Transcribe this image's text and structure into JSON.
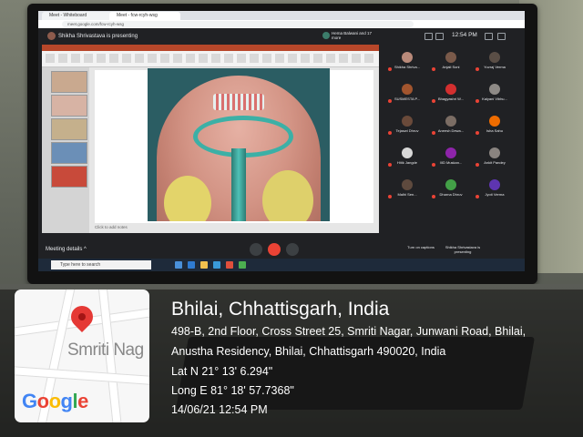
{
  "browser": {
    "tab1": "Meet - Whiteboard",
    "tab2": "Meet - fcw-rcyh-wsg",
    "url": "meet.google.com/fcw-rcyh-wsg"
  },
  "meet": {
    "presenting_text": "Shikha Shrivastava is presenting",
    "joined_text": "Hema Balwani and 17 more",
    "clock": "12:54 PM",
    "meeting_details": "Meeting details",
    "add_notes": "Click to add notes",
    "captions_label": "Turn on captions",
    "presenting_label": "Shikha Shrivastava is presenting",
    "participants": [
      {
        "name": "Shikha Shriva...",
        "color": "#b98a7a"
      },
      {
        "name": "Anjali Soni",
        "color": "#7a5a4a"
      },
      {
        "name": "Yuvraj Verma",
        "color": "#5a4e46"
      },
      {
        "name": "SUSMESTA P...",
        "color": "#a2552e"
      },
      {
        "name": "Bhagyashri W...",
        "color": "#d32f2f"
      },
      {
        "name": "Kalyani Vibhu...",
        "color": "#8e8a86"
      },
      {
        "name": "Tejaswi Dhruv",
        "color": "#6a4a3a"
      },
      {
        "name": "Aneesh Dewa...",
        "color": "#7b6d64"
      },
      {
        "name": "Isha Sahu",
        "color": "#ef6c00"
      },
      {
        "name": "Hitik Jangde",
        "color": "#d8d8d8"
      },
      {
        "name": "IIID Muskan...",
        "color": "#8e24aa"
      },
      {
        "name": "Ankit Pandey",
        "color": "#8a8480"
      },
      {
        "name": "Malhi Sen...",
        "color": "#5e4a3e"
      },
      {
        "name": "Dharna Dhruv",
        "color": "#43a047"
      },
      {
        "name": "Jyoti Verma",
        "color": "#5e35b1"
      }
    ]
  },
  "taskbar": {
    "search_placeholder": "Type here to search"
  },
  "map": {
    "street_label": "Smriti Nag",
    "logo": "Google"
  },
  "location": {
    "title": "Bhilai, Chhattisgarh, India",
    "address_line1": "498-B, 2nd Floor, Cross Street 25, Smriti Nagar, Junwani Road, Bhilai,",
    "address_line2": "Anustha Residency, Bhilai, Chhattisgarh 490020, India",
    "lat": "Lat N 21° 13' 6.294\"",
    "long": "Long E 81° 18' 57.7368\"",
    "datetime": "14/06/21 12:54 PM"
  }
}
